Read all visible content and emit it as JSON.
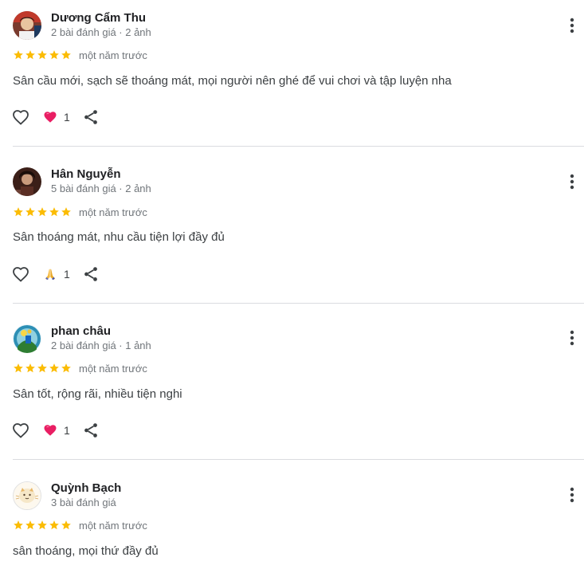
{
  "reviews": [
    {
      "name": "Dương Cẩm Thu",
      "meta": "2 bài đánh giá · 2 ảnh",
      "rating": 5,
      "time": "một năm trước",
      "text": "Sân cầu mới, sạch sẽ thoáng mát, mọi người nên ghé để vui chơi và tập luyện nha",
      "reaction_icon": "heart-icon",
      "reaction_count": "1"
    },
    {
      "name": "Hân Nguyễn",
      "meta": "5 bài đánh giá · 2 ảnh",
      "rating": 5,
      "time": "một năm trước",
      "text": "Sân thoáng mát, nhu cầu tiện lợi đầy đủ",
      "reaction_icon": "praying-hands-icon",
      "reaction_count": "1"
    },
    {
      "name": "phan châu",
      "meta": "2 bài đánh giá · 1 ảnh",
      "rating": 5,
      "time": "một năm trước",
      "text": "Sân tốt, rộng rãi, nhiều tiện nghi",
      "reaction_icon": "heart-icon",
      "reaction_count": "1"
    },
    {
      "name": "Quỳnh Bạch",
      "meta": "3 bài đánh giá",
      "rating": 5,
      "time": "một năm trước",
      "text": "sân thoáng, mọi thứ đầy đủ"
    }
  ],
  "colors": {
    "star": "#fbbc04",
    "heart_reaction": "#e91e63",
    "divider": "#dadce0",
    "secondary_text": "#70757a"
  }
}
